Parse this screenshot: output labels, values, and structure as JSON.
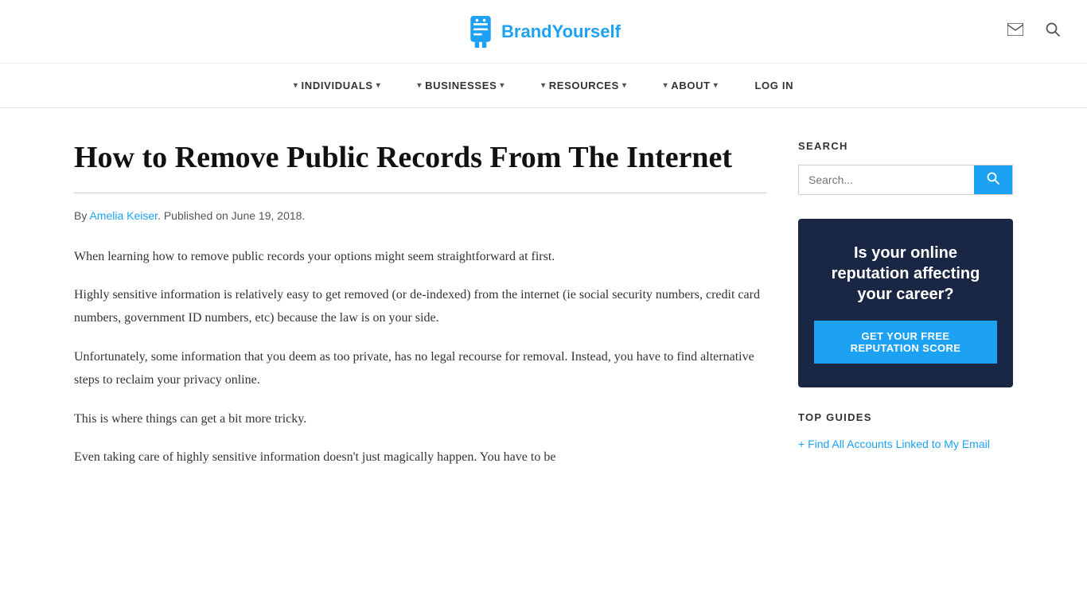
{
  "header": {
    "logo_text": "BrandYourself",
    "logo_icon_alt": "brand-yourself-logo"
  },
  "nav": {
    "items": [
      {
        "label": "INDIVIDUALS",
        "has_dropdown": true
      },
      {
        "label": "BUSINESSES",
        "has_dropdown": true
      },
      {
        "label": "RESOURCES",
        "has_dropdown": true
      },
      {
        "label": "ABOUT",
        "has_dropdown": true
      },
      {
        "label": "LOG IN",
        "has_dropdown": false
      }
    ]
  },
  "article": {
    "title": "How to Remove Public Records From The Internet",
    "meta_prefix": "By ",
    "author": "Amelia Keiser",
    "meta_suffix": ". Published on June 19, 2018.",
    "paragraphs": [
      "When learning how to remove public records your options might seem straightforward at first.",
      "Highly sensitive information is relatively easy to get removed (or de-indexed) from the internet (ie social security numbers, credit card numbers, government ID numbers, etc) because the law is on your side.",
      "Unfortunately, some information that you deem as too private, has no legal recourse for removal. Instead, you have to find alternative steps to reclaim your privacy online.",
      "This is where things can get a bit more tricky.",
      "Even taking care of highly sensitive information doesn't just magically happen. You have to be"
    ]
  },
  "sidebar": {
    "search_section_title": "SEARCH",
    "search_placeholder": "Search...",
    "search_button_label": "Search",
    "ad_banner": {
      "text": "Is your online reputation affecting your career?",
      "button_label": "GET YOUR FREE REPUTATION SCORE"
    },
    "top_guides_title": "TOP GUIDES",
    "top_guides_links": [
      "Find All Accounts Linked to My Email"
    ]
  }
}
